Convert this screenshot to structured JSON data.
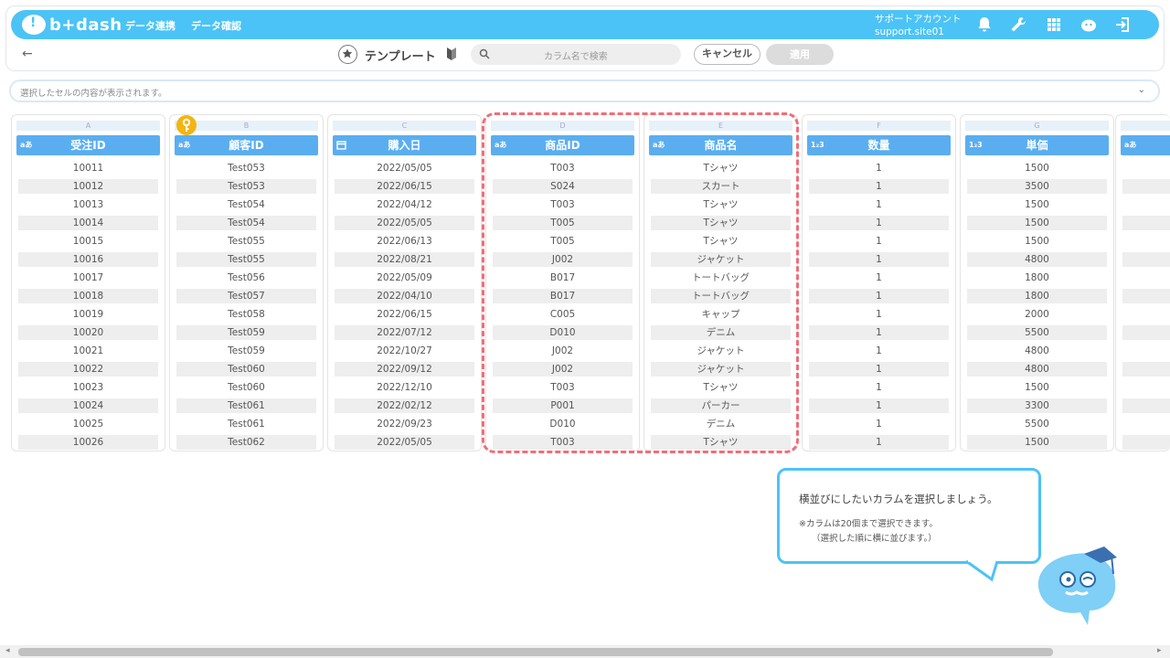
{
  "header": {
    "logo": "b+dash",
    "nav": [
      "データ連携",
      "データ確認"
    ],
    "account_name": "サポートアカウント",
    "account_id": "support.site01"
  },
  "toolbar": {
    "back": "←",
    "title": "テンプレート",
    "search_placeholder": "カラム名で検索",
    "cancel": "キャンセル",
    "apply": "適用"
  },
  "cellbar": {
    "placeholder": "選択したセルの内容が表示されます。"
  },
  "columns": [
    {
      "letter": "A",
      "type": "aあ",
      "name": "受注ID",
      "values": [
        "10011",
        "10012",
        "10013",
        "10014",
        "10015",
        "10016",
        "10017",
        "10018",
        "10019",
        "10020",
        "10021",
        "10022",
        "10023",
        "10024",
        "10025",
        "10026"
      ]
    },
    {
      "letter": "B",
      "type": "aあ",
      "name": "顧客ID",
      "values": [
        "Test053",
        "Test053",
        "Test054",
        "Test054",
        "Test055",
        "Test055",
        "Test056",
        "Test057",
        "Test058",
        "Test059",
        "Test059",
        "Test060",
        "Test060",
        "Test061",
        "Test061",
        "Test062"
      ]
    },
    {
      "letter": "C",
      "type": "date",
      "name": "購入日",
      "values": [
        "2022/05/05",
        "2022/06/15",
        "2022/04/12",
        "2022/05/05",
        "2022/06/13",
        "2022/08/21",
        "2022/05/09",
        "2022/04/10",
        "2022/06/15",
        "2022/07/12",
        "2022/10/27",
        "2022/09/12",
        "2022/12/10",
        "2022/02/12",
        "2022/09/23",
        "2022/05/05"
      ]
    },
    {
      "letter": "D",
      "type": "aあ",
      "name": "商品ID",
      "values": [
        "T003",
        "S024",
        "T003",
        "T005",
        "T005",
        "J002",
        "B017",
        "B017",
        "C005",
        "D010",
        "J002",
        "J002",
        "T003",
        "P001",
        "D010",
        "T003"
      ]
    },
    {
      "letter": "E",
      "type": "aあ",
      "name": "商品名",
      "values": [
        "Tシャツ",
        "スカート",
        "Tシャツ",
        "Tシャツ",
        "Tシャツ",
        "ジャケット",
        "トートバッグ",
        "トートバッグ",
        "キャップ",
        "デニム",
        "ジャケット",
        "ジャケット",
        "Tシャツ",
        "パーカー",
        "デニム",
        "Tシャツ"
      ]
    },
    {
      "letter": "F",
      "type": "1₂3",
      "name": "数量",
      "values": [
        "1",
        "1",
        "1",
        "1",
        "1",
        "1",
        "1",
        "1",
        "1",
        "1",
        "1",
        "1",
        "1",
        "1",
        "1",
        "1"
      ]
    },
    {
      "letter": "G",
      "type": "1₂3",
      "name": "単価",
      "values": [
        "1500",
        "3500",
        "1500",
        "1500",
        "1500",
        "4800",
        "1800",
        "1800",
        "2000",
        "5500",
        "4800",
        "4800",
        "1500",
        "3300",
        "5500",
        "1500"
      ]
    }
  ],
  "partial_column": {
    "type": "aあ"
  },
  "tooltip": {
    "line1": "横並びにしたいカラムを選択しましょう。",
    "line2": "※カラムは20個まで選択できます。",
    "line3": "（選択した順に横に並びます。）"
  },
  "colors": {
    "brand": "#4cc3f6",
    "header_col": "#5aaef0",
    "highlight": "#ef6e78"
  }
}
